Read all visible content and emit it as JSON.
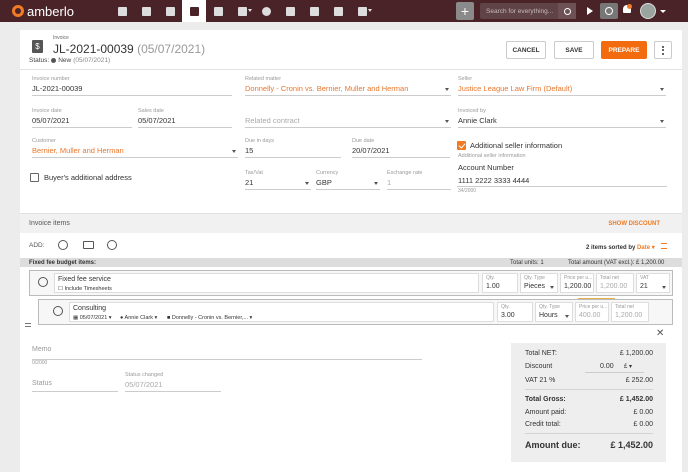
{
  "brand": "amberlo",
  "nav": [
    "dashboard-icon",
    "contacts-icon",
    "matters-icon",
    "invoices-icon",
    "finance-icon",
    "calendar-icon",
    "time-icon",
    "folder-icon",
    "documents-icon",
    "mail-icon",
    "more-icon"
  ],
  "search": {
    "placeholder": "Search for everything..."
  },
  "header": {
    "doc_type": "Invoice",
    "number": "JL-2021-00039",
    "date": "(05/07/2021)",
    "status_label": "Status:",
    "status": "New",
    "status_date": "(05/07/2021)",
    "cancel": "CANCEL",
    "save": "SAVE",
    "prepare": "PREPARE"
  },
  "fields": {
    "invoice_number": {
      "label": "Invoice number",
      "value": "JL-2021-00039"
    },
    "related_matter": {
      "label": "Related matter",
      "value": "Donnelly - Cronin vs. Bernier, Muller and Herman"
    },
    "seller": {
      "label": "Seller",
      "value": "Justice League Law Firm (Default)"
    },
    "invoice_date": {
      "label": "Invoice date",
      "value": "05/07/2021"
    },
    "sales_date": {
      "label": "Sales date",
      "value": "05/07/2021"
    },
    "related_contract": {
      "label": "",
      "value": "Related contract"
    },
    "invoiced_by": {
      "label": "Invoiced by",
      "value": "Annie Clark"
    },
    "customer": {
      "label": "Customer",
      "value": "Bernier, Muller and Herman"
    },
    "due_in_days": {
      "label": "Due in days",
      "value": "15"
    },
    "due_date": {
      "label": "Due date",
      "value": "20/07/2021"
    },
    "additional_seller": {
      "label": "Additional seller information",
      "checked": true
    },
    "seller_info_label": "Additional seller information",
    "seller_info_value1": "Account Number",
    "seller_info_value2": "1111 2222 3333 4444",
    "seller_info_count": "34/2000",
    "buyer_address": {
      "label": "Buyer's additional address",
      "checked": false
    },
    "tax": {
      "label": "Tax/Vat",
      "value": "21"
    },
    "currency": {
      "label": "Currency",
      "value": "GBP"
    },
    "exchange": {
      "label": "Exchange rate",
      "value": "1"
    }
  },
  "items": {
    "title": "Invoice items",
    "show_discount": "SHOW DISCOUNT",
    "add_label": "ADD:",
    "sorted_count": "2 items sorted by",
    "sorted_by": "Date",
    "budget_label": "Fixed fee budget items:",
    "total_units": "Total units: 1",
    "total_amount": "Total amount (VAT excl.): £ 1,200.00",
    "rows": [
      {
        "name": "Fixed fee service",
        "include": "Include Timesheets",
        "qty_label": "Qty.",
        "qty": "1.00",
        "qtype_label": "Qty. Type",
        "qtype": "Pieces",
        "price_label": "Price per u...",
        "price": "1,200.00",
        "net_label": "Total net",
        "net": "1,200.00",
        "vat_label": "VAT",
        "vat": "21"
      },
      {
        "name": "Consulting",
        "date": "05/07/2021",
        "person": "Annie Clark",
        "matter": "Donnelly - Cronin vs. Bernier,...",
        "qty_label": "Qty.",
        "qty": "3.00",
        "qtype_label": "Qty. Type",
        "qtype": "Hours",
        "price_label": "Price per u...",
        "price": "400.00",
        "net_label": "Total net",
        "net": "1,200.00"
      }
    ]
  },
  "memo": {
    "label": "Memo",
    "count": "0/2000",
    "status_label": "Status",
    "status_changed_label": "Status changed",
    "status_changed": "05/07/2021"
  },
  "totals": {
    "net_label": "Total NET:",
    "net": "£ 1,200.00",
    "discount_label": "Discount",
    "discount": "0.00",
    "discount_cur": "£",
    "vat_label": "VAT 21 %",
    "vat": "£ 252.00",
    "gross_label": "Total Gross:",
    "gross": "£ 1,452.00",
    "paid_label": "Amount paid:",
    "paid": "£ 0.00",
    "credit_label": "Credit total:",
    "credit": "£ 0.00",
    "due_label": "Amount due:",
    "due": "£ 1,452.00"
  }
}
